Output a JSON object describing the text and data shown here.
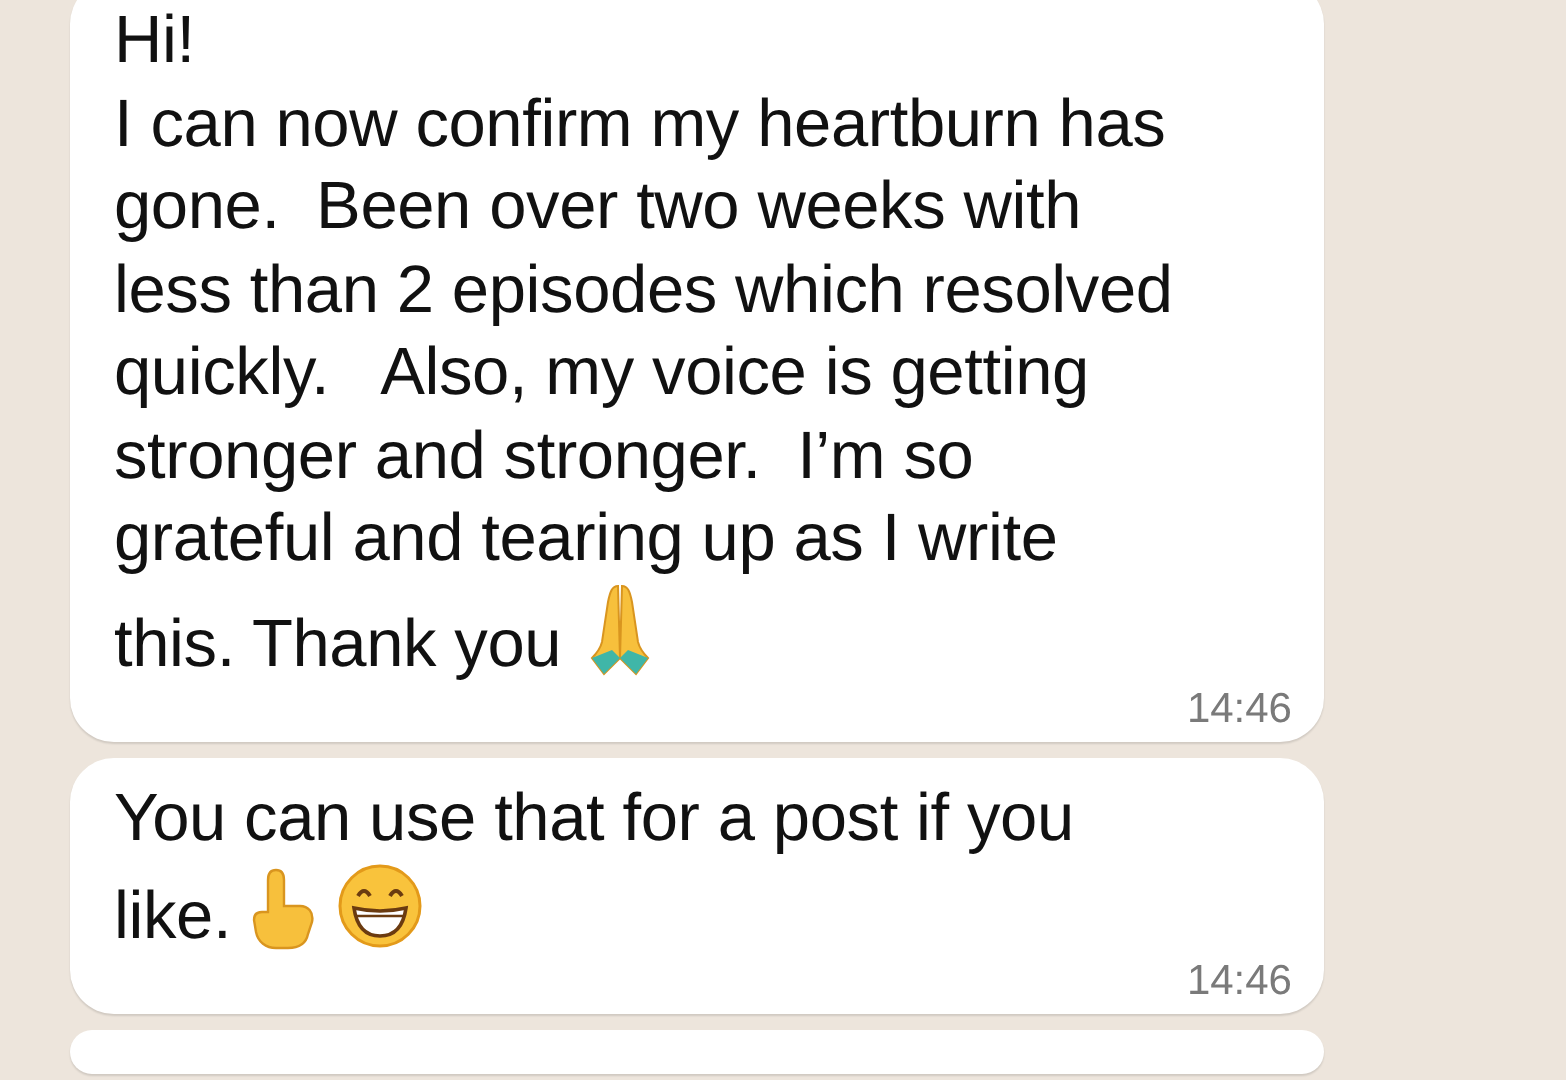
{
  "messages": [
    {
      "kind": "text",
      "text": "Hi!\nI can now confirm my heartburn has\ngone.  Been over two weeks with\nless than 2 episodes which resolved\nquickly.   Also, my voice is getting\nstronger and stronger.  I’m so\ngrateful and tearing up as I write\nthis. Thank you",
      "time": "14:46"
    },
    {
      "kind": "text",
      "text": "You can use that for a post if you\nlike.",
      "time": "14:46"
    },
    {
      "kind": "partial"
    }
  ]
}
